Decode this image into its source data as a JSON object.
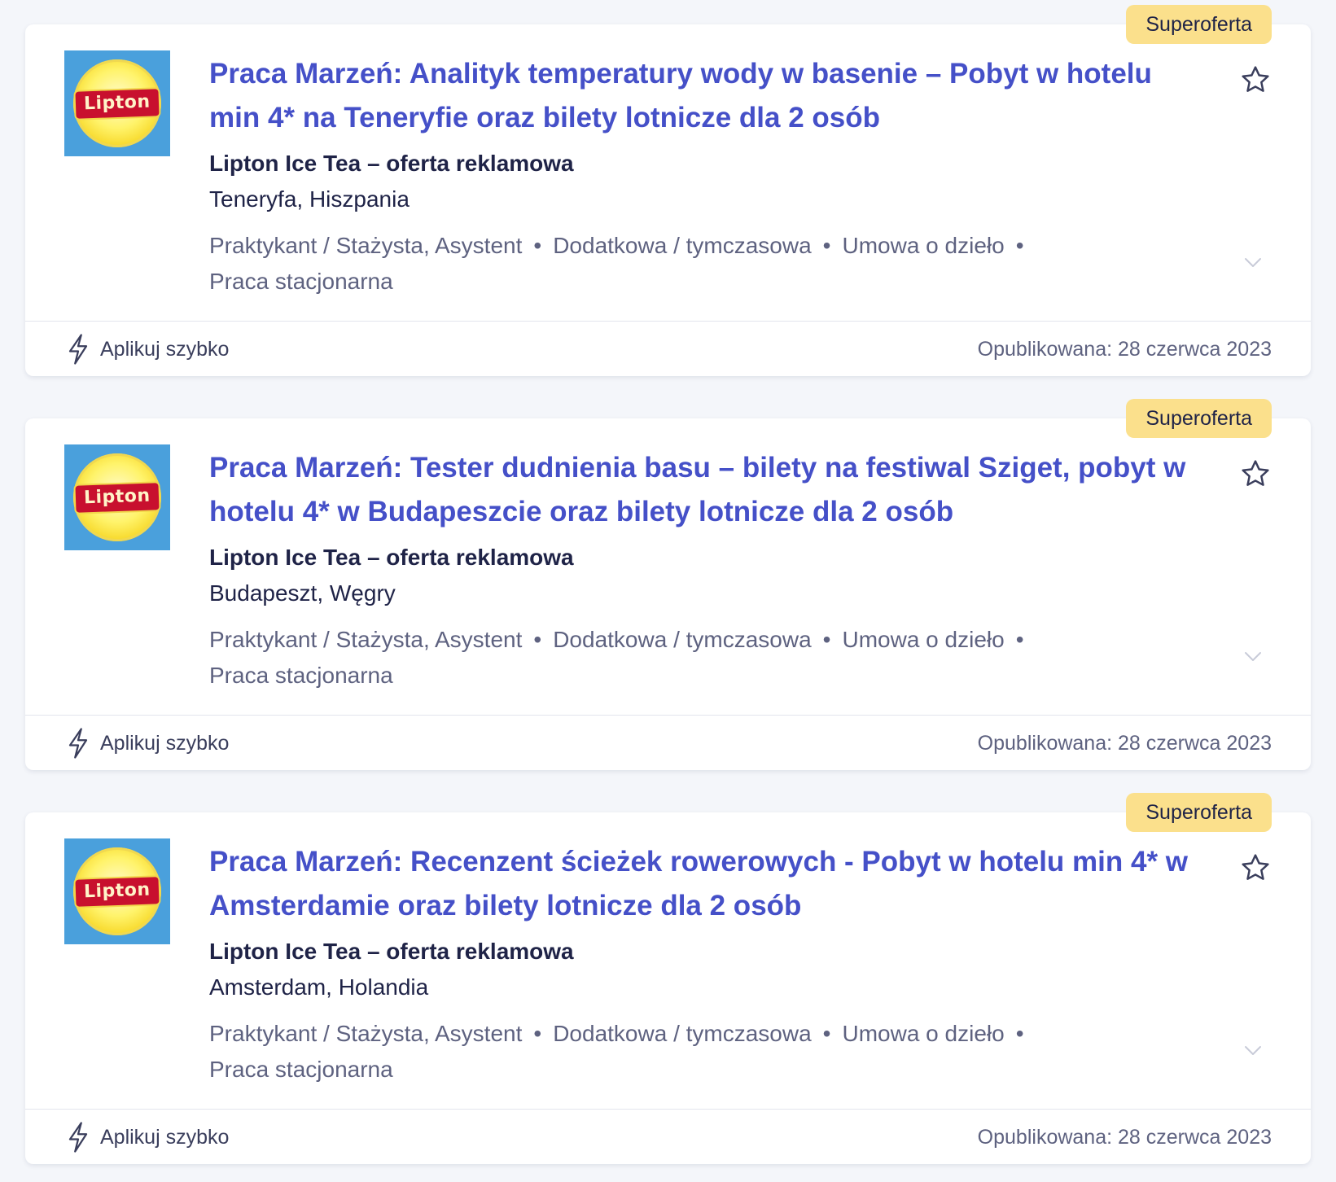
{
  "offers": [
    {
      "badge": "Superoferta",
      "logo_text": "Lipton",
      "title": "Praca Marzeń: Analityk temperatury wody w basenie – Pobyt w hotelu min 4* na Teneryfie oraz bilety lotnicze dla 2 osób",
      "company": "Lipton Ice Tea – oferta reklamowa",
      "location": "Teneryfa, Hiszpania",
      "tags": [
        "Praktykant / Stażysta, Asystent",
        "Dodatkowa / tymczasowa",
        "Umowa o dzieło",
        "Praca stacjonarna"
      ],
      "apply_label": "Aplikuj szybko",
      "published": "Opublikowana: 28 czerwca 2023"
    },
    {
      "badge": "Superoferta",
      "logo_text": "Lipton",
      "title": "Praca Marzeń: Tester dudnienia basu – bilety na festiwal Sziget, pobyt w hotelu 4* w Budapeszcie oraz bilety lotnicze dla 2 osób",
      "company": "Lipton Ice Tea – oferta reklamowa",
      "location": "Budapeszt, Węgry",
      "tags": [
        "Praktykant / Stażysta, Asystent",
        "Dodatkowa / tymczasowa",
        "Umowa o dzieło",
        "Praca stacjonarna"
      ],
      "apply_label": "Aplikuj szybko",
      "published": "Opublikowana: 28 czerwca 2023"
    },
    {
      "badge": "Superoferta",
      "logo_text": "Lipton",
      "title": "Praca Marzeń: Recenzent ścieżek rowerowych - Pobyt w hotelu min 4* w Amsterdamie oraz bilety lotnicze dla 2 osób",
      "company": "Lipton Ice Tea – oferta reklamowa",
      "location": "Amsterdam, Holandia",
      "tags": [
        "Praktykant / Stażysta, Asystent",
        "Dodatkowa / tymczasowa",
        "Umowa o dzieło",
        "Praca stacjonarna"
      ],
      "apply_label": "Aplikuj szybko",
      "published": "Opublikowana: 28 czerwca 2023"
    }
  ],
  "icons": {
    "favorite": "star-icon",
    "expand": "chevron-down-icon",
    "quick_apply": "lightning-icon"
  },
  "colors": {
    "title": "#4550c8",
    "badge_bg": "#fbe08c",
    "logo_bg": "#4aa0dc",
    "logo_ribbon": "#c8102e"
  }
}
